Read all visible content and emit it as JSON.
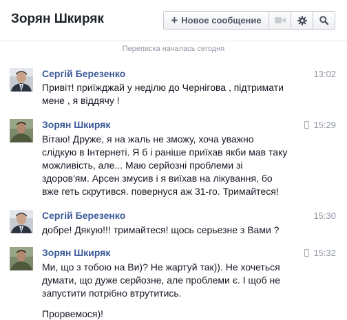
{
  "header": {
    "title": "Зорян Шкиряк",
    "new_message_label": "Новое сообщение",
    "video_icon": "video-camera-icon",
    "settings_icon": "gear-icon",
    "search_icon": "search-icon"
  },
  "conversation": {
    "started_label": "Переписка началась сегодня"
  },
  "messages": [
    {
      "sender": "Сергій Березенко",
      "time": "13:02",
      "via_mobile": false,
      "lines": [
        "Привіт! приїжджай у неділю до Чернігова , підтримати",
        "мене , я віддячу !"
      ]
    },
    {
      "sender": "Зорян Шкиряк",
      "time": "15:29",
      "via_mobile": true,
      "lines": [
        "Вітаю! Друже, я на жаль не зможу, хоча уважно",
        "слідкую в Інтернеті. Я б і раніше приїхав якби мав таку",
        "можливість, але... Маю серйозні проблеми зі",
        "здоров'ям. Арсен змусив і я виїхав на лікування, бо",
        "вже геть скрутився.  повернуся аж 31-го. Тримайтеся!"
      ]
    },
    {
      "sender": "Сергій Березенко",
      "time": "15:30",
      "via_mobile": false,
      "lines": [
        "добре! Дякую!!! тримайтеся! щось серьезне з Вами ?"
      ]
    },
    {
      "sender": "Зорян Шкиряк",
      "time": "15:32",
      "via_mobile": true,
      "lines": [
        "Ми, що з тобою на Ви)? Не жартуй так)). Не хочеться",
        "думати, що дуже серйозне, але проблеми є. І щоб не",
        "запустити потрібно втрутитись."
      ],
      "extra_line": "Прорвемося)!"
    }
  ],
  "colors": {
    "sender_name": "#3b5998",
    "timestamp": "#9197a3",
    "text": "#141823"
  }
}
